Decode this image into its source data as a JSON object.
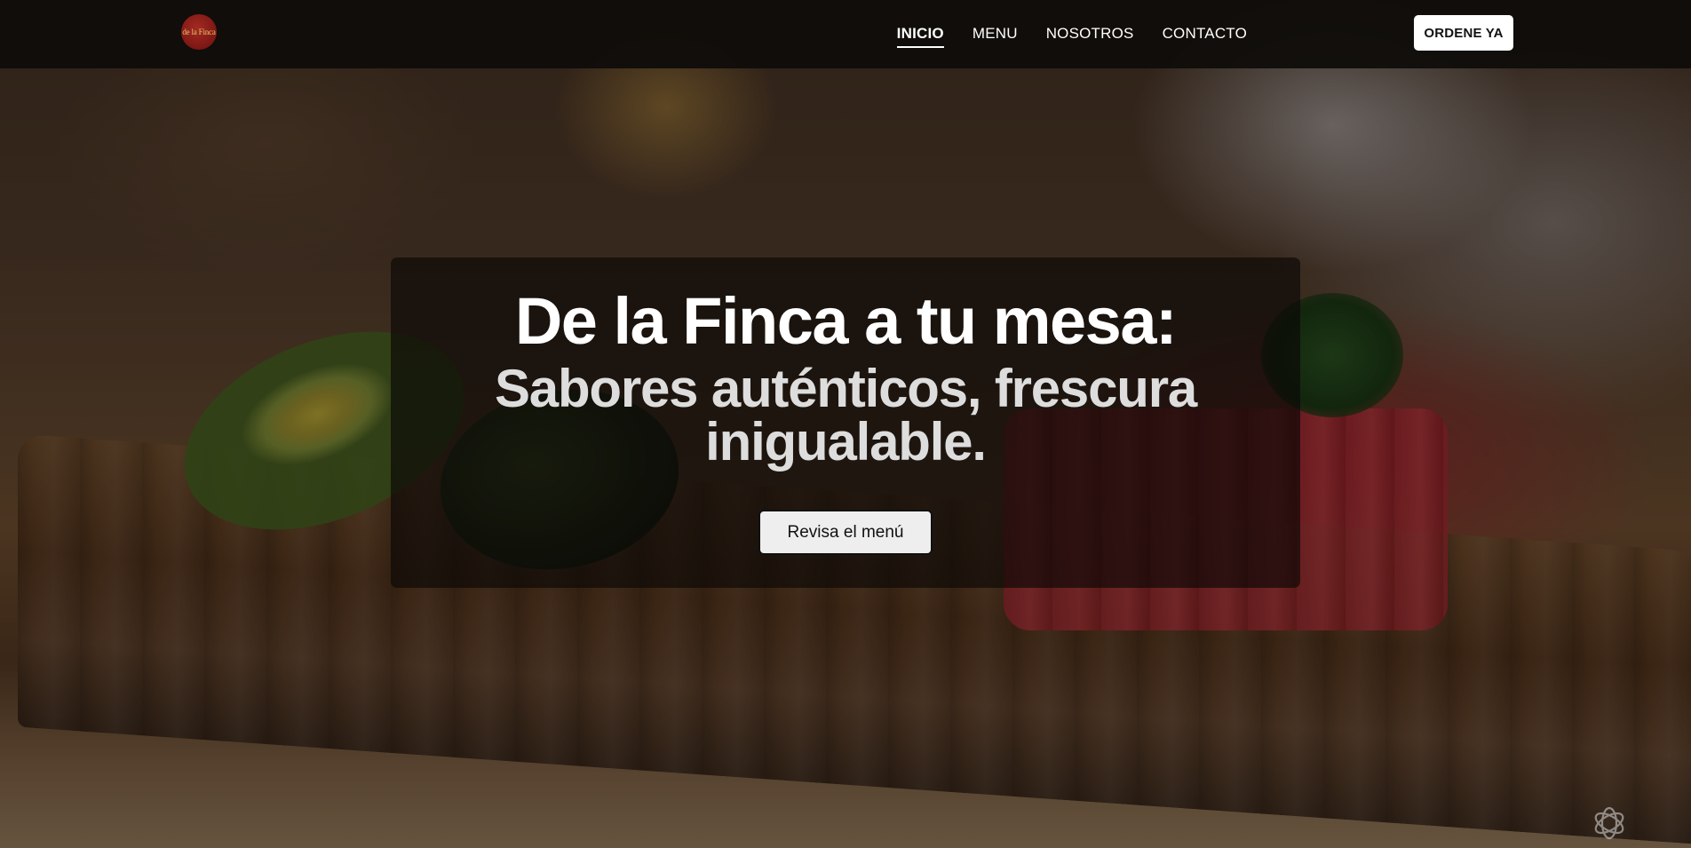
{
  "brand": {
    "logo_text": "de la Finca"
  },
  "nav": {
    "items": [
      {
        "label": "INICIO",
        "active": true
      },
      {
        "label": "MENU",
        "active": false
      },
      {
        "label": "NOSOTROS",
        "active": false
      },
      {
        "label": "CONTACTO",
        "active": false
      }
    ],
    "cta_label": "ORDENE YA"
  },
  "hero": {
    "title": "De la Finca a tu mesa:",
    "subtitle": "Sabores auténticos, frescura inigualable.",
    "button_label": "Revisa el menú"
  },
  "icons": {
    "corner": "openai-knot-icon"
  },
  "colors": {
    "navbar_bg": "#0e0c0a",
    "logo_red": "#7d1714",
    "cta_bg": "#ffffff",
    "hero_panel": "#0a0806"
  }
}
